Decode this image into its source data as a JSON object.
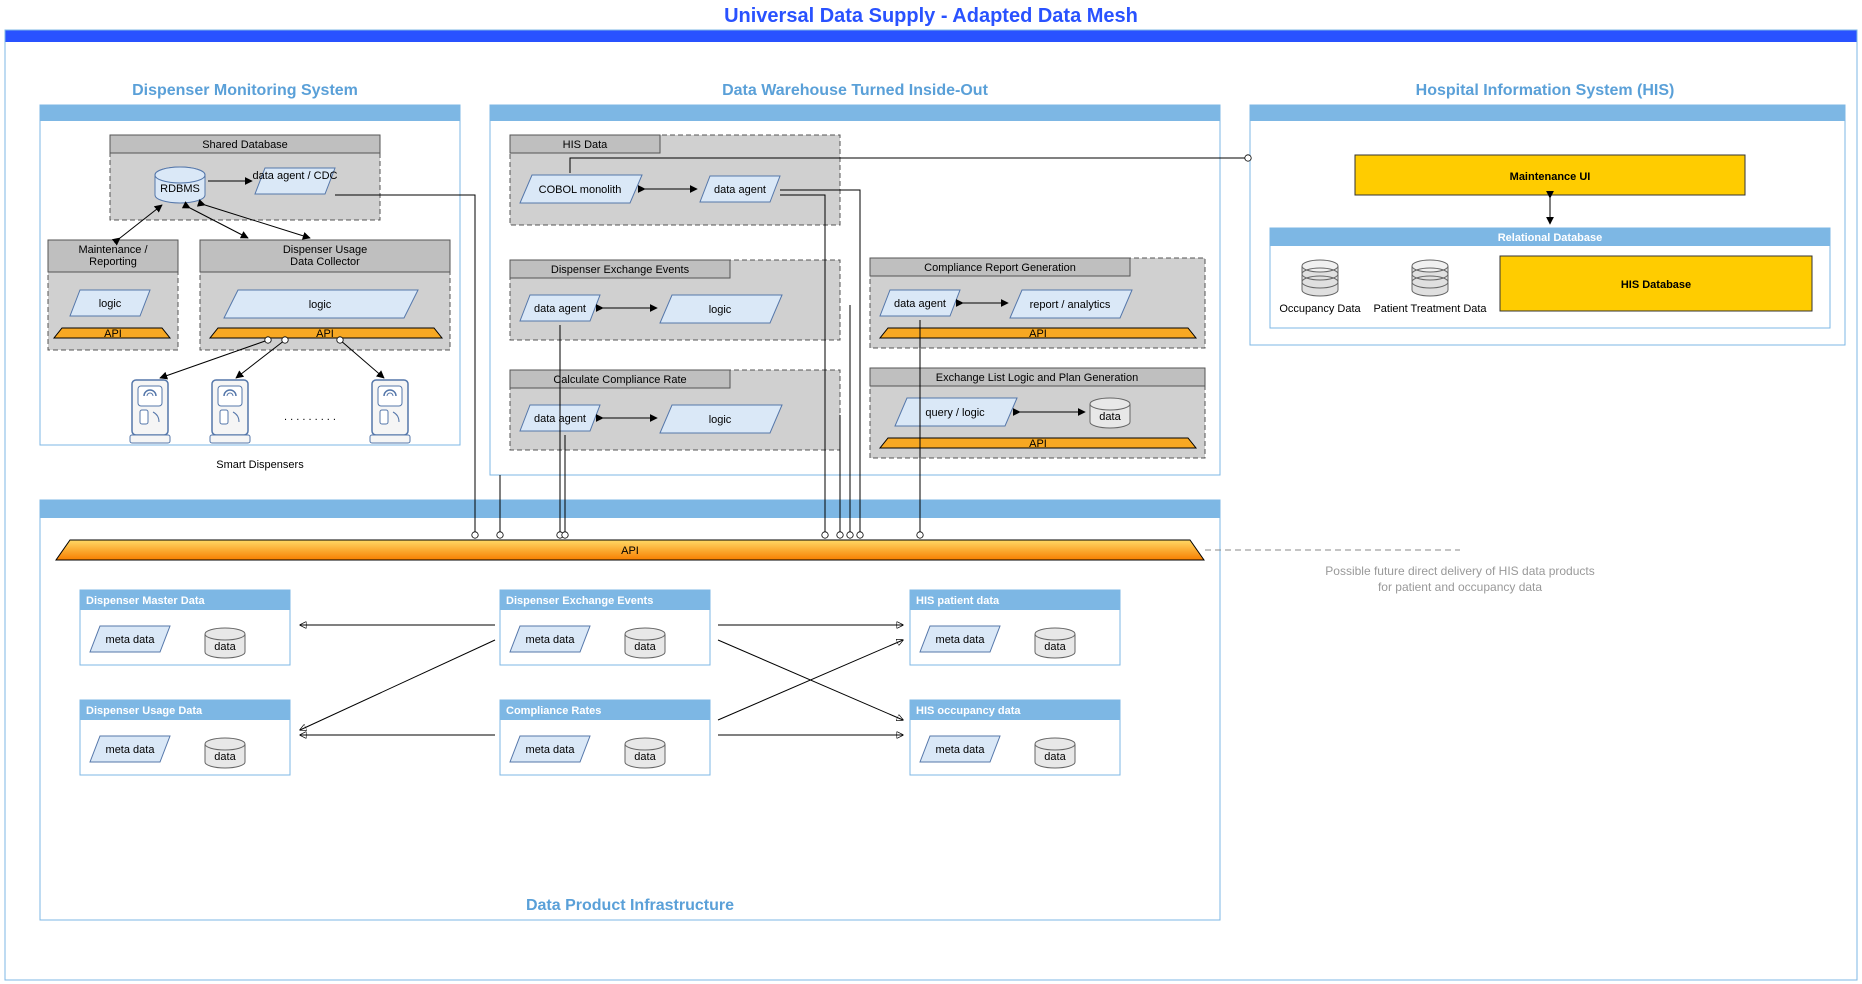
{
  "title": "Universal Data Supply - Adapted Data Mesh",
  "sections": {
    "dms": "Dispenser Monitoring System",
    "dwh": "Data Warehouse Turned Inside-Out",
    "his": "Hospital Information System (HIS)",
    "dpi": "Data Product Infrastructure"
  },
  "dms": {
    "shared_db": "Shared Database",
    "rdbms": "RDBMS",
    "agent_cdc": "data agent /\nCDC",
    "maintenance": "Maintenance /\nReporting",
    "collector": "Dispenser Usage\nData Collector",
    "logic": "logic",
    "api": "API",
    "dispensers": "Smart Dispensers"
  },
  "dwh": {
    "his_data": "HIS Data",
    "cobol": "COBOL monolith",
    "agent": "data agent",
    "dee": "Dispenser Exchange Events",
    "ccr": "Calculate Compliance Rate",
    "crg": "Compliance Report Generation",
    "ellpg": "Exchange List Logic and Plan Generation",
    "logic": "logic",
    "report": "report / analytics",
    "query": "query / logic",
    "data": "data",
    "api": "API"
  },
  "his": {
    "maint_ui": "Maintenance UI",
    "rel_db": "Relational Database",
    "occ": "Occupancy Data",
    "pat": "Patient Treatment Data",
    "db": "HIS Database"
  },
  "dpi": {
    "api": "API",
    "meta": "meta data",
    "data": "data",
    "products": {
      "dmd": "Dispenser Master Data",
      "dud": "Dispenser Usage Data",
      "dee": "Dispenser Exchange Events",
      "cr": "Compliance Rates",
      "hpd": "HIS patient data",
      "hod": "HIS occupancy data"
    },
    "note": "Possible future direct delivery of HIS data products\nfor patient and occupancy data"
  }
}
